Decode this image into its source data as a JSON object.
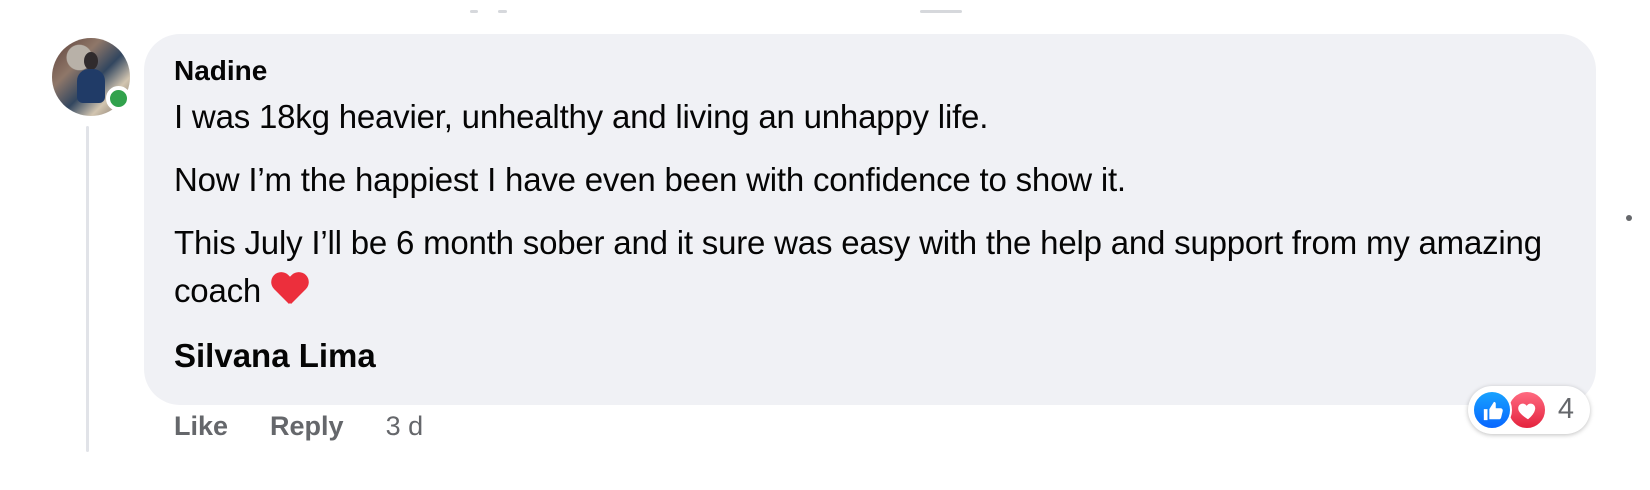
{
  "comment": {
    "author": "Nadine",
    "paragraphs": [
      "I was 18kg heavier, unhealthy and living an unhappy life.",
      "Now I’m the happiest I have even been with confidence to show it.",
      "This July I’ll be 6 month sober and it sure was easy with the help and support from my amazing coach"
    ],
    "signature": "Silvana Lima"
  },
  "actions": {
    "like": "Like",
    "reply": "Reply",
    "timestamp": "3 d"
  },
  "reactions": {
    "count": "4",
    "icons": [
      "like-icon",
      "love-icon"
    ]
  },
  "status": {
    "online": true
  },
  "icons": {
    "heart": "heart-emoji-icon",
    "thumbs_up": "thumbs-up-icon"
  },
  "colors": {
    "bubble": "#f0f1f5",
    "online": "#31a24c",
    "like": "#0866ff",
    "love": "#e4233e",
    "secondary_text": "#65676b"
  }
}
